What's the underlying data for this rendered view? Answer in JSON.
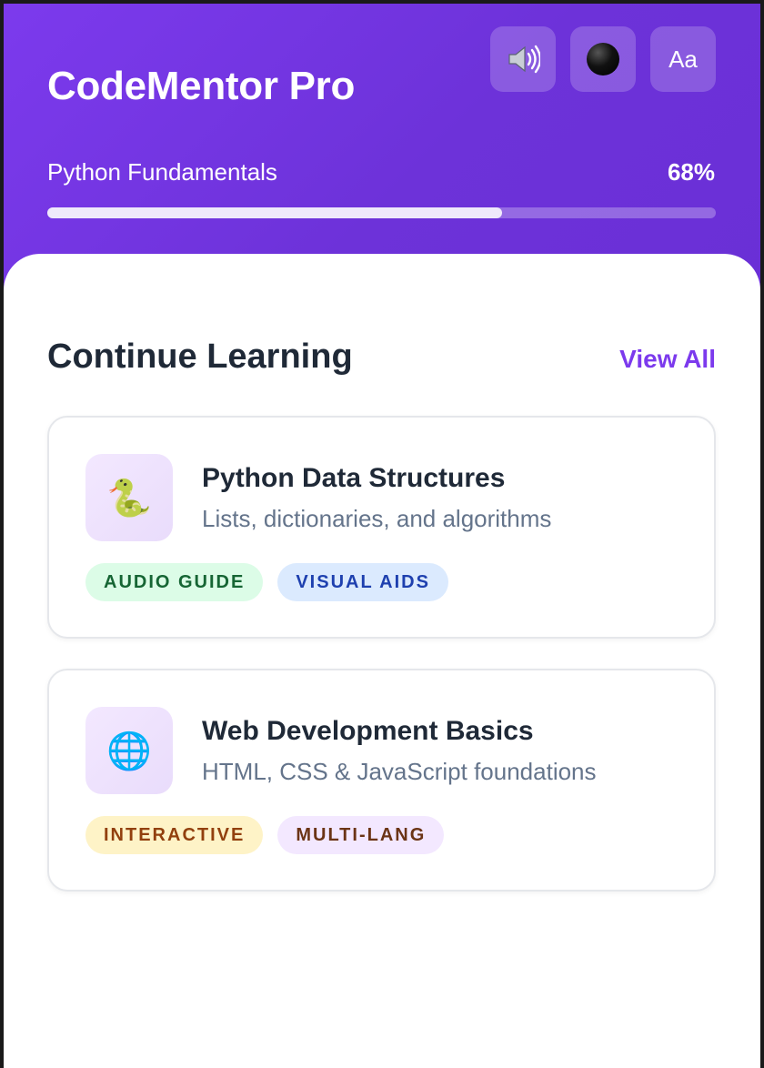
{
  "app": {
    "title": "CodeMentor Pro"
  },
  "toolbar": {
    "audio_icon": "speaker-icon",
    "contrast_icon": "contrast-icon",
    "font_label": "Aa"
  },
  "progress": {
    "course": "Python Fundamentals",
    "percent_label": "68%",
    "value": 0.68
  },
  "section": {
    "title": "Continue Learning",
    "view_all": "View All"
  },
  "courses": [
    {
      "icon": "🐍",
      "icon_name": "snake-icon",
      "title": "Python Data Structures",
      "subtitle": "Lists, dictionaries, and algorithms",
      "tags": [
        {
          "label": "AUDIO GUIDE",
          "bg": "#dcfce7",
          "fg": "#166534"
        },
        {
          "label": "VISUAL AIDS",
          "bg": "#dbeafe",
          "fg": "#1e40af"
        }
      ]
    },
    {
      "icon": "🌐",
      "icon_name": "globe-icon",
      "title": "Web Development Basics",
      "subtitle": "HTML, CSS & JavaScript foundations",
      "tags": [
        {
          "label": "INTERACTIVE",
          "bg": "#fef3c7",
          "fg": "#92400e"
        },
        {
          "label": "MULTI-LANG",
          "bg": "#f3e8ff",
          "fg": "#6b3415"
        }
      ]
    }
  ],
  "colors": {
    "accent": "#7c3aed",
    "hero_start": "#7c3aed",
    "hero_end": "#6a2fd6",
    "heading": "#1f2937",
    "muted": "#64748b"
  }
}
